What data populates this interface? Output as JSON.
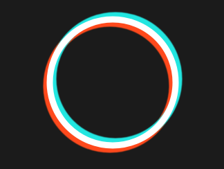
{
  "logo": {
    "icon": "ring-logo-icon",
    "description_colors": {
      "background": "#1b1b1b",
      "red_channel": "#ff4a1c",
      "cyan_channel": "#22e6e0",
      "core": "#ffffff"
    }
  }
}
